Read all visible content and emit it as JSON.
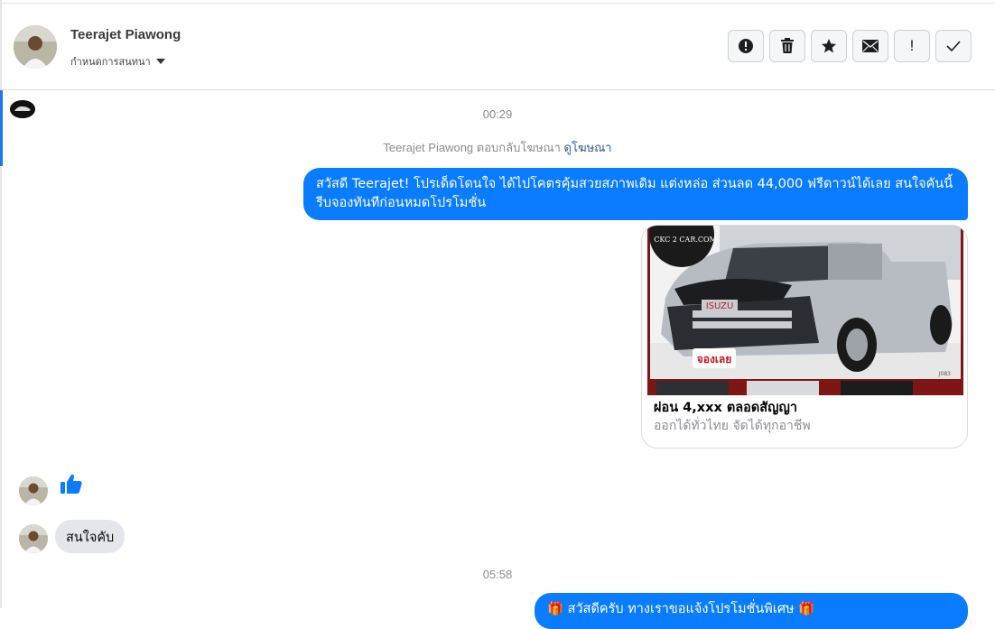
{
  "header": {
    "contact_name": "Teerajet Piawong",
    "conversation_setting": "กำหนดการสนทนา"
  },
  "toolbar": {
    "buttons": [
      {
        "icon": "alert-circle-icon"
      },
      {
        "icon": "trash-icon"
      },
      {
        "icon": "star-icon"
      },
      {
        "icon": "envelope-icon"
      },
      {
        "icon": "exclamation-icon",
        "label": "!"
      },
      {
        "icon": "checkmark-icon"
      }
    ]
  },
  "thread": {
    "time1": "00:29",
    "ad_reply_text": "Teerajet Piawong ตอบกลับโฆษณา",
    "ad_reply_link": "ดูโฆษณา",
    "message1": "สวัสดี Teerajet! โปรเด็ดโดนใจ ได้ไปโคตรคุ้มสวยสภาพเดิม แต่งหล่อ ส่วนลด 44,000 ฟรีดาวน์ได้เลย สนใจคันนี้ รีบจองทันทีก่อนหมดโปรโมชั่น",
    "card": {
      "watermark": "CKC 2 CAR.COM",
      "badge": "จองเลย",
      "grille_logo": "ISUZU",
      "title": "ผ่อน 4,xxx ตลอดสัญญา",
      "subtitle": "ออกได้ทั่วไทย จัดได้ทุกอาชีพ"
    },
    "reply_text": "สนใจคับ",
    "time2": "05:58",
    "message2": "🎁 สวัสดีครับ ทางเราขอแจ้งโปรโมชั่นพิเศษ 🎁"
  },
  "colors": {
    "accent": "#0a7cff",
    "link": "#385898",
    "incoming_bubble": "#e4e6eb"
  }
}
